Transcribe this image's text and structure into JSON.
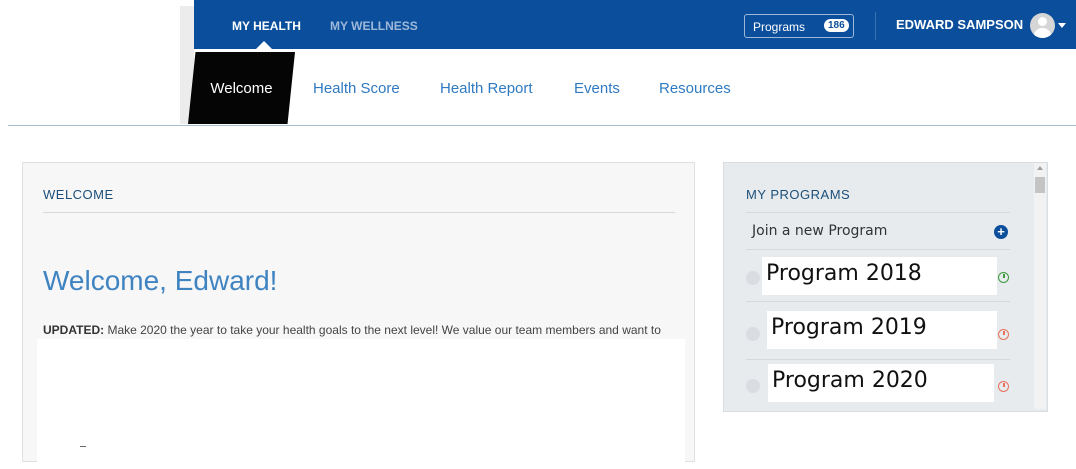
{
  "topnav": {
    "my_health": "MY HEALTH",
    "my_wellness": "MY WELLNESS",
    "programs_label": "Programs",
    "programs_count": "186",
    "user_name": "EDWARD SAMPSON"
  },
  "tabs": {
    "active": "Welcome",
    "items": [
      "Health Score",
      "Health Report",
      "Events",
      "Resources"
    ]
  },
  "welcome": {
    "section_title": "WELCOME",
    "heading": "Welcome, Edward!",
    "updated_label": "UPDATED:",
    "body": "Make 2020 the year to take your health goals to the next level!  We value our team members and want to encourage healthy behaviors."
  },
  "my_programs": {
    "title": "MY PROGRAMS",
    "join_label": "Join a new Program",
    "programs": [
      {
        "name": "Program 2018",
        "status_color": "#3d9a3d"
      },
      {
        "name": "Program 2019",
        "status_color": "#e8705b"
      },
      {
        "name": "Program 2020",
        "status_color": "#e8705b"
      }
    ]
  },
  "colors": {
    "brand": "#0b4f9c",
    "link": "#2f7ac1",
    "heading": "#3f83c1"
  }
}
